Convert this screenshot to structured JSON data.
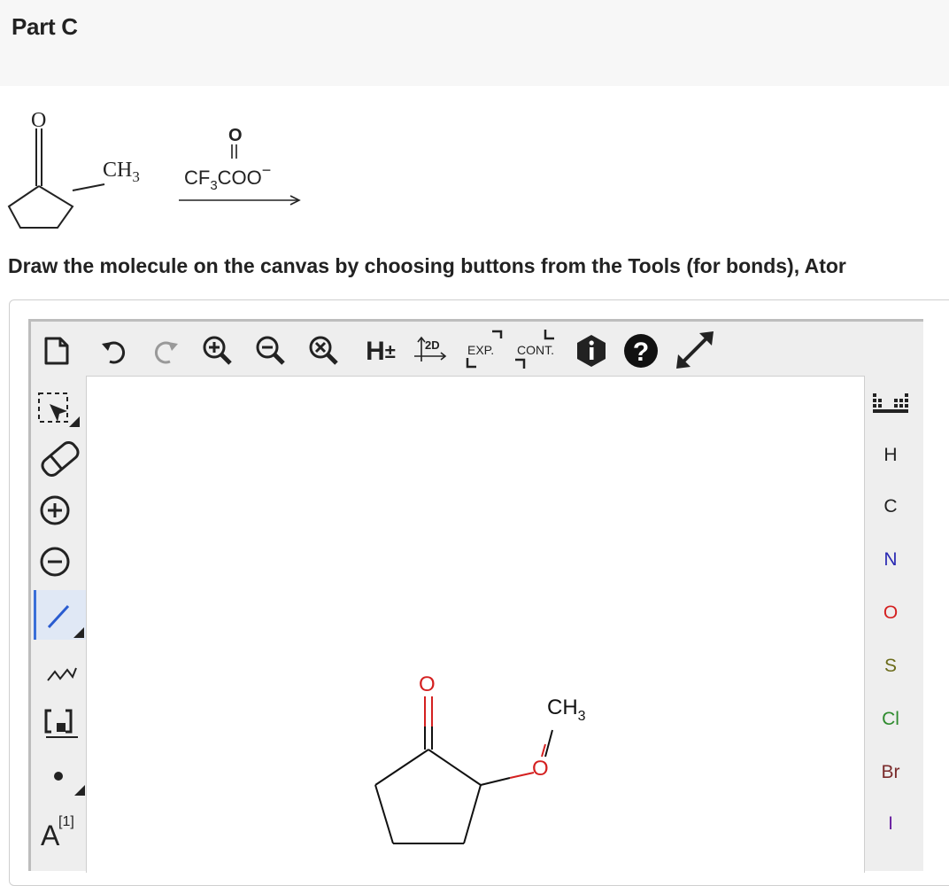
{
  "part": {
    "title": "Part C"
  },
  "reaction": {
    "reactant_substituent": "CH",
    "reactant_substituent_sub": "3",
    "reagent_carbonyl_o": "O",
    "reagent_formula_pre": "CF",
    "reagent_formula_sub": "3",
    "reagent_formula_post": "COO",
    "reagent_charge": "−",
    "reactant_carbonyl_o": "O"
  },
  "instruction": "Draw the molecule on the canvas by choosing buttons from the Tools (for bonds), Ator",
  "toolbar": {
    "h_label": "H",
    "h_pm": "±",
    "twod_label": "2D",
    "exp_label": "EXP.",
    "cont_label": "CONT."
  },
  "left_tools": {
    "charge_label_index": "[1]",
    "charge_label_letter": "A"
  },
  "atoms": [
    "H",
    "C",
    "N",
    "O",
    "S",
    "Cl",
    "Br",
    "I"
  ],
  "atom_colors": {
    "H": "#222222",
    "C": "#222222",
    "N": "#2b2bb3",
    "O": "#d42020",
    "S": "#6b6b1a",
    "Cl": "#2e8b2e",
    "Br": "#7a2b2b",
    "I": "#6a1fa0"
  },
  "canvas_molecule": {
    "methyl": "CH",
    "methyl_sub": "3",
    "ether_o": "O",
    "carbonyl_o": "O"
  }
}
